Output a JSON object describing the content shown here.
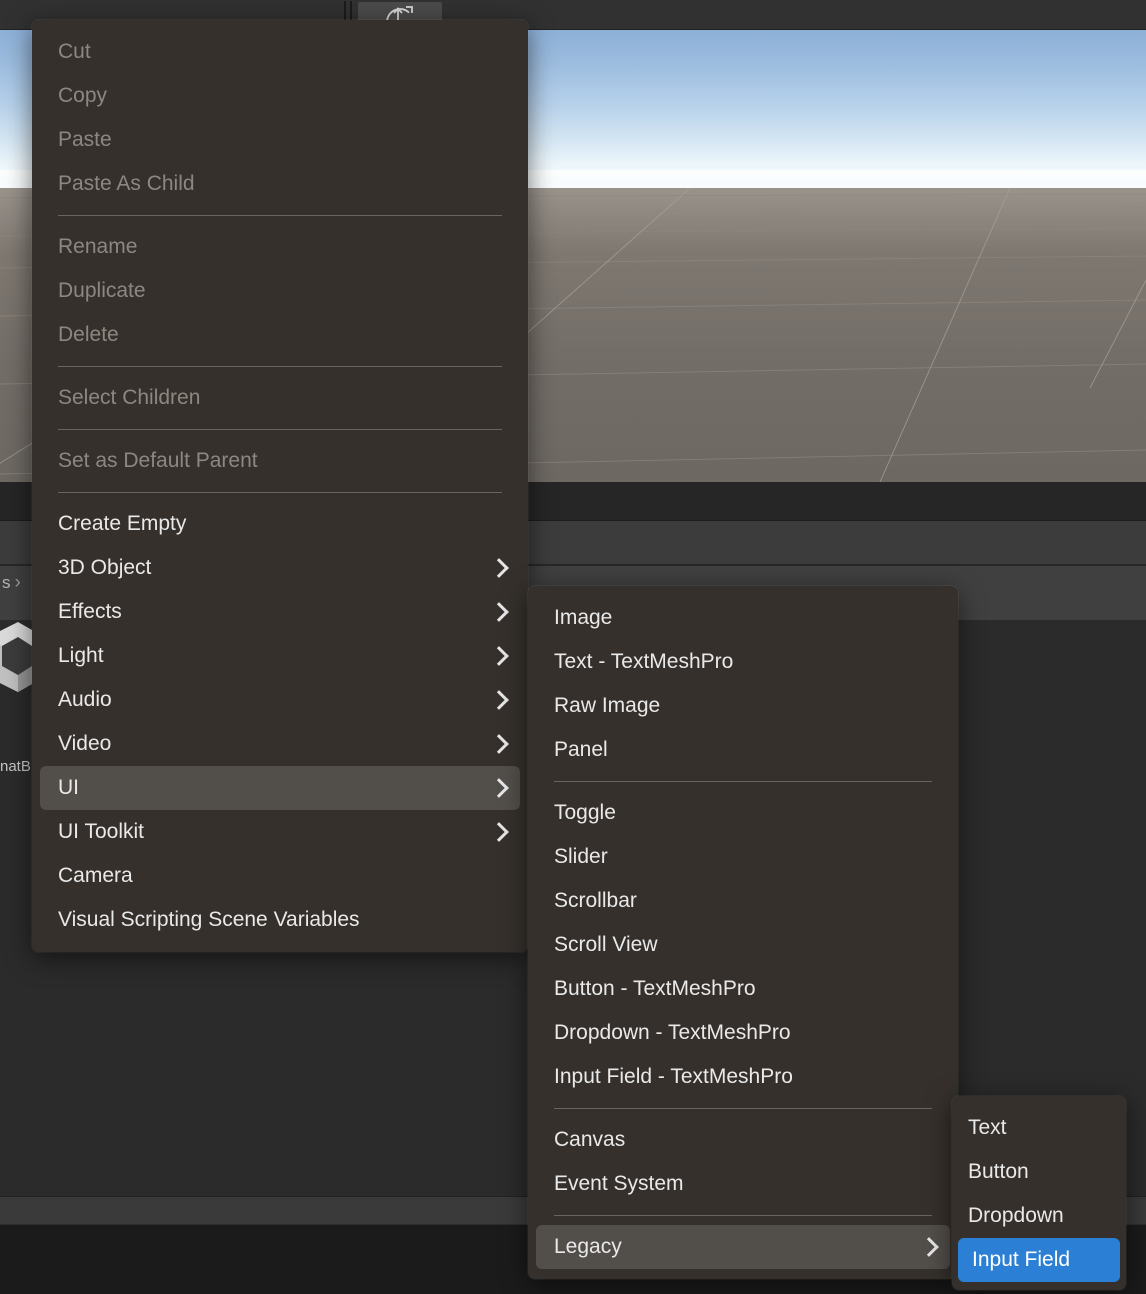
{
  "app": {
    "name": "Unity Editor",
    "toolbar_icon": "scene-camera-icon"
  },
  "background": {
    "breadcrumb_fragment": "s",
    "breadcrumb_chevron": "›",
    "asset_label_fragment": "natB",
    "logo": "unity-cube-logo"
  },
  "context_menu": {
    "name": "hierarchy-context-menu",
    "groups": [
      {
        "items": [
          {
            "label": "Cut",
            "disabled": true,
            "submenu": false
          },
          {
            "label": "Copy",
            "disabled": true,
            "submenu": false
          },
          {
            "label": "Paste",
            "disabled": true,
            "submenu": false
          },
          {
            "label": "Paste As Child",
            "disabled": true,
            "submenu": false
          }
        ]
      },
      {
        "items": [
          {
            "label": "Rename",
            "disabled": true,
            "submenu": false
          },
          {
            "label": "Duplicate",
            "disabled": true,
            "submenu": false
          },
          {
            "label": "Delete",
            "disabled": true,
            "submenu": false
          }
        ]
      },
      {
        "items": [
          {
            "label": "Select Children",
            "disabled": true,
            "submenu": false
          }
        ]
      },
      {
        "items": [
          {
            "label": "Set as Default Parent",
            "disabled": true,
            "submenu": false
          }
        ]
      },
      {
        "items": [
          {
            "label": "Create Empty",
            "disabled": false,
            "submenu": false,
            "highlighted": false
          },
          {
            "label": "3D Object",
            "disabled": false,
            "submenu": true,
            "highlighted": false
          },
          {
            "label": "Effects",
            "disabled": false,
            "submenu": true,
            "highlighted": false
          },
          {
            "label": "Light",
            "disabled": false,
            "submenu": true,
            "highlighted": false
          },
          {
            "label": "Audio",
            "disabled": false,
            "submenu": true,
            "highlighted": false
          },
          {
            "label": "Video",
            "disabled": false,
            "submenu": true,
            "highlighted": false
          },
          {
            "label": "UI",
            "disabled": false,
            "submenu": true,
            "highlighted": true
          },
          {
            "label": "UI Toolkit",
            "disabled": false,
            "submenu": true,
            "highlighted": false
          },
          {
            "label": "Camera",
            "disabled": false,
            "submenu": false,
            "highlighted": false
          },
          {
            "label": "Visual Scripting Scene Variables",
            "disabled": false,
            "submenu": false,
            "highlighted": false
          }
        ]
      }
    ]
  },
  "ui_submenu": {
    "name": "ui-submenu",
    "groups": [
      {
        "items": [
          {
            "label": "Image",
            "submenu": false,
            "highlighted": false
          },
          {
            "label": "Text - TextMeshPro",
            "submenu": false,
            "highlighted": false
          },
          {
            "label": "Raw Image",
            "submenu": false,
            "highlighted": false
          },
          {
            "label": "Panel",
            "submenu": false,
            "highlighted": false
          }
        ]
      },
      {
        "items": [
          {
            "label": "Toggle",
            "submenu": false,
            "highlighted": false
          },
          {
            "label": "Slider",
            "submenu": false,
            "highlighted": false
          },
          {
            "label": "Scrollbar",
            "submenu": false,
            "highlighted": false
          },
          {
            "label": "Scroll View",
            "submenu": false,
            "highlighted": false
          },
          {
            "label": "Button - TextMeshPro",
            "submenu": false,
            "highlighted": false
          },
          {
            "label": "Dropdown - TextMeshPro",
            "submenu": false,
            "highlighted": false
          },
          {
            "label": "Input Field - TextMeshPro",
            "submenu": false,
            "highlighted": false
          }
        ]
      },
      {
        "items": [
          {
            "label": "Canvas",
            "submenu": false,
            "highlighted": false
          },
          {
            "label": "Event System",
            "submenu": false,
            "highlighted": false
          }
        ]
      },
      {
        "items": [
          {
            "label": "Legacy",
            "submenu": true,
            "highlighted": true
          }
        ]
      }
    ]
  },
  "legacy_submenu": {
    "name": "legacy-submenu",
    "groups": [
      {
        "items": [
          {
            "label": "Text",
            "submenu": false,
            "highlighted": false,
            "selected": false
          },
          {
            "label": "Button",
            "submenu": false,
            "highlighted": false,
            "selected": false
          },
          {
            "label": "Dropdown",
            "submenu": false,
            "highlighted": false,
            "selected": false
          },
          {
            "label": "Input Field",
            "submenu": false,
            "highlighted": false,
            "selected": true
          }
        ]
      }
    ]
  },
  "colors": {
    "menu_background": "#35302c",
    "menu_highlight": "#524e4a",
    "selection_blue": "#2b7fd4",
    "text_enabled": "#e9e9e9",
    "text_disabled": "#8e8781",
    "separator": "#6a645e",
    "editor_chrome": "#2b2b2b",
    "sky_top": "#8db0d8",
    "ground": "#736d67"
  }
}
